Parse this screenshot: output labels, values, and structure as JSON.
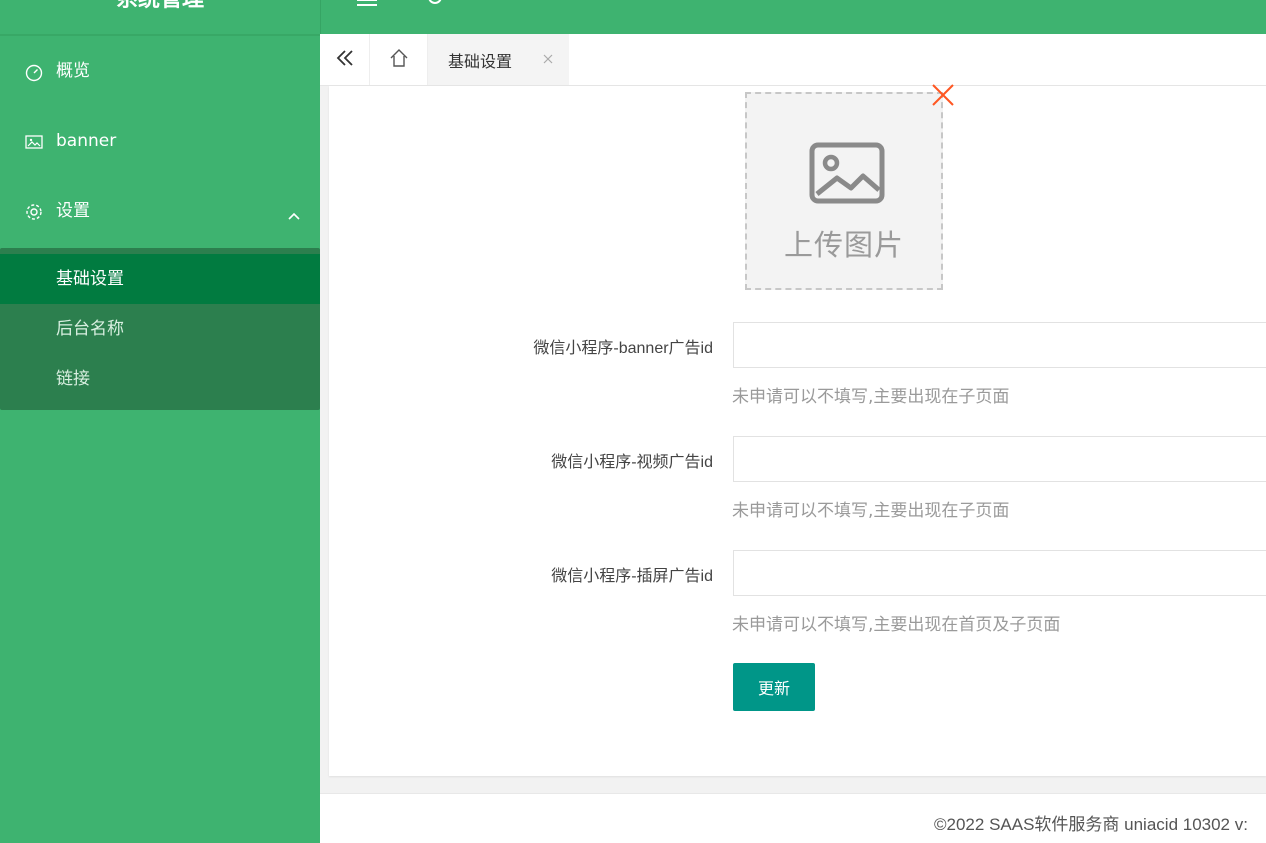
{
  "app": {
    "title": "系统管理"
  },
  "sidebar": {
    "items": [
      {
        "label": "概览",
        "icon": "dashboard-icon"
      },
      {
        "label": "banner",
        "icon": "image-icon"
      },
      {
        "label": "设置",
        "icon": "gear-icon",
        "expanded": true
      }
    ],
    "submenu": [
      {
        "label": "基础设置",
        "active": true
      },
      {
        "label": "后台名称",
        "active": false
      },
      {
        "label": "链接",
        "active": false
      }
    ]
  },
  "tabs": {
    "active_label": "基础设置"
  },
  "upload": {
    "text": "上传图片"
  },
  "form": {
    "rows": [
      {
        "label": "微信小程序-banner广告id",
        "value": "",
        "hint": "未申请可以不填写,主要出现在子页面"
      },
      {
        "label": "微信小程序-视频广告id",
        "value": "",
        "hint": "未申请可以不填写,主要出现在子页面"
      },
      {
        "label": "微信小程序-插屏广告id",
        "value": "",
        "hint": "未申请可以不填写,主要出现在首页及子页面"
      }
    ],
    "submit_label": "更新"
  },
  "footer": {
    "text": "©2022 SAAS软件服务商 uniacid 10302   v:"
  },
  "colors": {
    "sidebar_bg": "#3eb370",
    "submenu_bg": "#2c7f4e",
    "active_item_bg": "#017b40",
    "button_bg": "#009688",
    "remove_x": "#ff5722"
  }
}
